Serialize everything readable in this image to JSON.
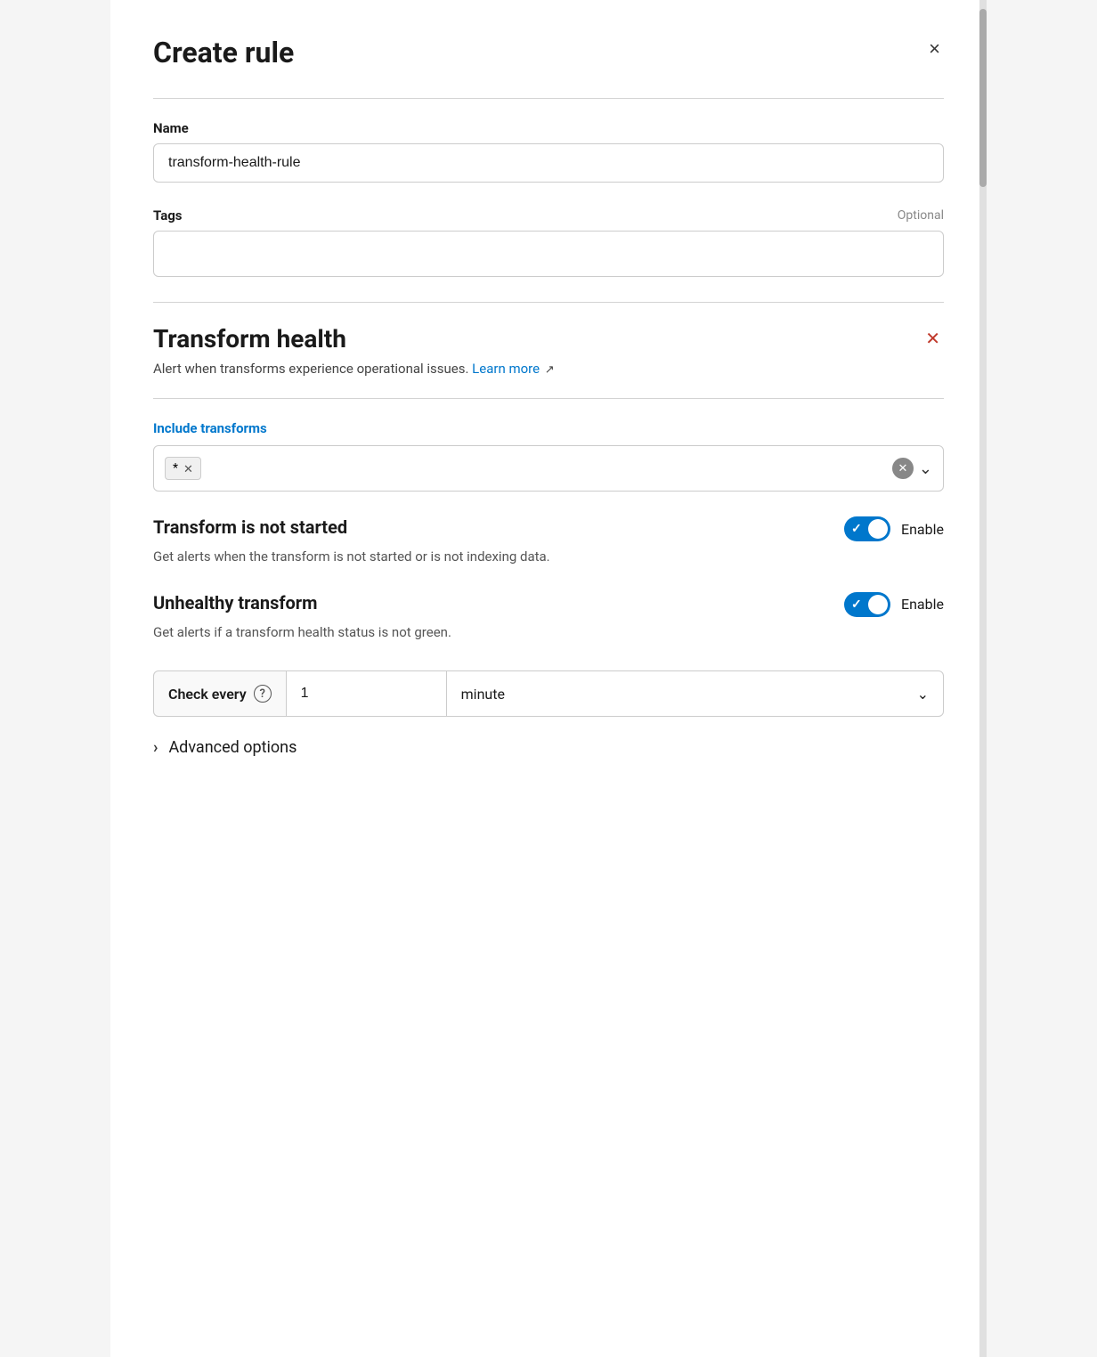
{
  "modal": {
    "title": "Create rule",
    "close_button_label": "×"
  },
  "name_field": {
    "label": "Name",
    "value": "transform-health-rule",
    "placeholder": ""
  },
  "tags_field": {
    "label": "Tags",
    "optional_label": "Optional",
    "value": "",
    "placeholder": ""
  },
  "transform_health_section": {
    "title": "Transform health",
    "description": "Alert when transforms experience operational issues.",
    "learn_more_text": "Learn more",
    "learn_more_href": "#",
    "remove_button_label": "×"
  },
  "include_transforms": {
    "label": "Include transforms",
    "tag_value": "*",
    "tag_remove_label": "×",
    "clear_button_label": "×",
    "dropdown_button_label": "▾"
  },
  "transform_not_started": {
    "title": "Transform is not started",
    "description": "Get alerts when the transform is not started or is not indexing data.",
    "toggle_enabled": true,
    "enable_label": "Enable"
  },
  "unhealthy_transform": {
    "title": "Unhealthy transform",
    "description": "Get alerts if a transform health status is not green.",
    "toggle_enabled": true,
    "enable_label": "Enable"
  },
  "check_every": {
    "label": "Check every",
    "help_icon": "?",
    "value": "1",
    "unit": "minute",
    "dropdown_icon": "▾"
  },
  "advanced_options": {
    "chevron": "›",
    "label": "Advanced options"
  }
}
